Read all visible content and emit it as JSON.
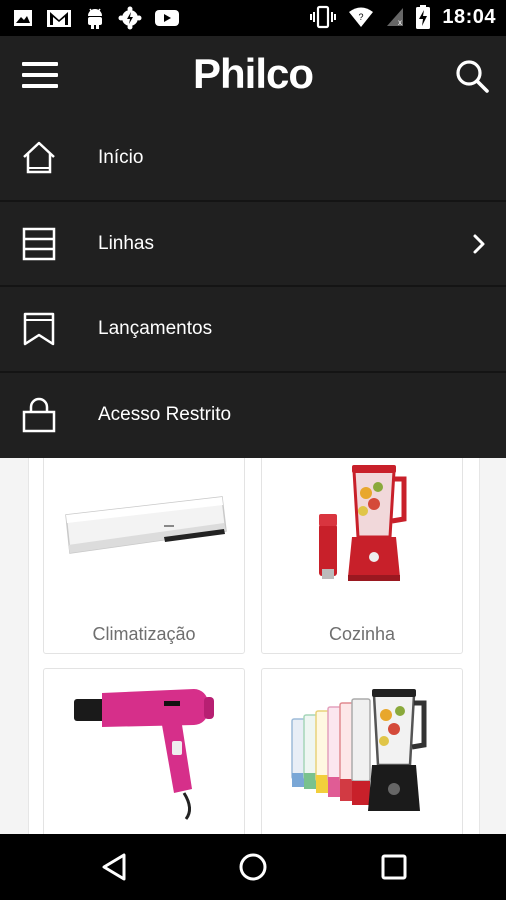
{
  "status_bar": {
    "time": "18:04",
    "left_icons": [
      "image-icon",
      "gmail-icon",
      "android-icon",
      "settings-bolt-icon",
      "youtube-icon"
    ],
    "right_icons": [
      "vibrate-icon",
      "wifi-icon",
      "signal-icon",
      "battery-charging-icon"
    ]
  },
  "app_bar": {
    "logo": "Philco",
    "menu_icon": "hamburger-icon",
    "search_icon": "search-icon",
    "background": "#202020"
  },
  "drawer": {
    "items": [
      {
        "label": "Início",
        "icon": "home-icon"
      },
      {
        "label": "Linhas",
        "icon": "list-icon",
        "chevron": true
      },
      {
        "label": "Lançamentos",
        "icon": "bookmark-icon"
      },
      {
        "label": "Acesso Restrito",
        "icon": "lock-icon"
      }
    ]
  },
  "categories": [
    {
      "label": "Climatização",
      "image": "air-conditioner"
    },
    {
      "label": "Cozinha",
      "image": "blender"
    },
    {
      "label": "",
      "image": "hair-dryer"
    },
    {
      "label": "",
      "image": "blender-lineup"
    }
  ],
  "nav_bar": {
    "back": "back-icon",
    "home": "home-circle-icon",
    "recents": "recents-icon"
  }
}
